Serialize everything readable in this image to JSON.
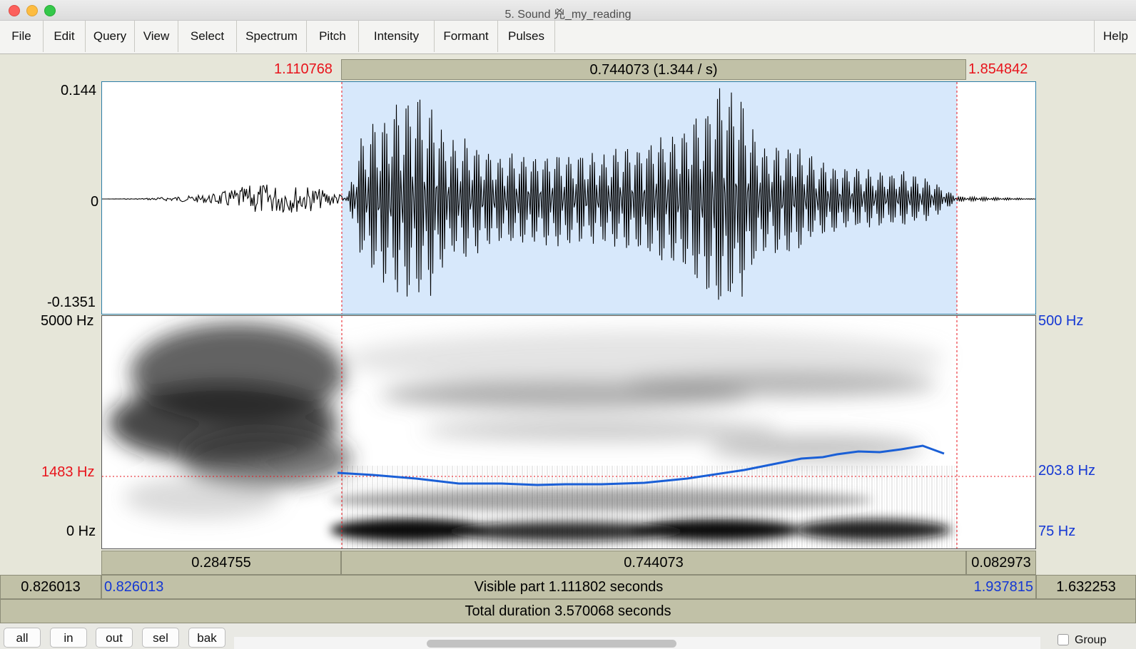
{
  "window": {
    "title": "5. Sound 兇_my_reading"
  },
  "menu": {
    "items": [
      "File",
      "Edit",
      "Query",
      "View",
      "Select",
      "Spectrum",
      "Pitch",
      "Intensity",
      "Formant",
      "Pulses"
    ],
    "help": "Help"
  },
  "selection": {
    "start": "1.110768",
    "end": "1.854842",
    "duration_label": "0.744073 (1.344  / s)"
  },
  "waveform": {
    "max_label": "0.144",
    "zero_label": "0",
    "min_label": "-0.1351"
  },
  "spectrogram": {
    "top_label": "5000 Hz",
    "cursor_label": "1483 Hz",
    "bottom_label": "0 Hz"
  },
  "pitch": {
    "top_label": "500 Hz",
    "cursor_label": "203.8 Hz",
    "bottom_label": "75 Hz",
    "line_color": "#1a5fd6"
  },
  "intervals": {
    "before": "0.284755",
    "selected": "0.744073",
    "after": "0.082973"
  },
  "visible": {
    "left_outside": "0.826013",
    "start": "0.826013",
    "label": "Visible part 1.111802 seconds",
    "end": "1.937815",
    "right_outside": "1.632253"
  },
  "total": {
    "label": "Total duration 3.570068 seconds"
  },
  "buttons": {
    "all": "all",
    "in": "in",
    "out": "out",
    "sel": "sel",
    "bak": "bak"
  },
  "group": {
    "label": "Group"
  },
  "colors": {
    "selection_bg": "#d7e8fb",
    "cursor_red": "#e8131b",
    "axis_blue": "#1437d4"
  }
}
